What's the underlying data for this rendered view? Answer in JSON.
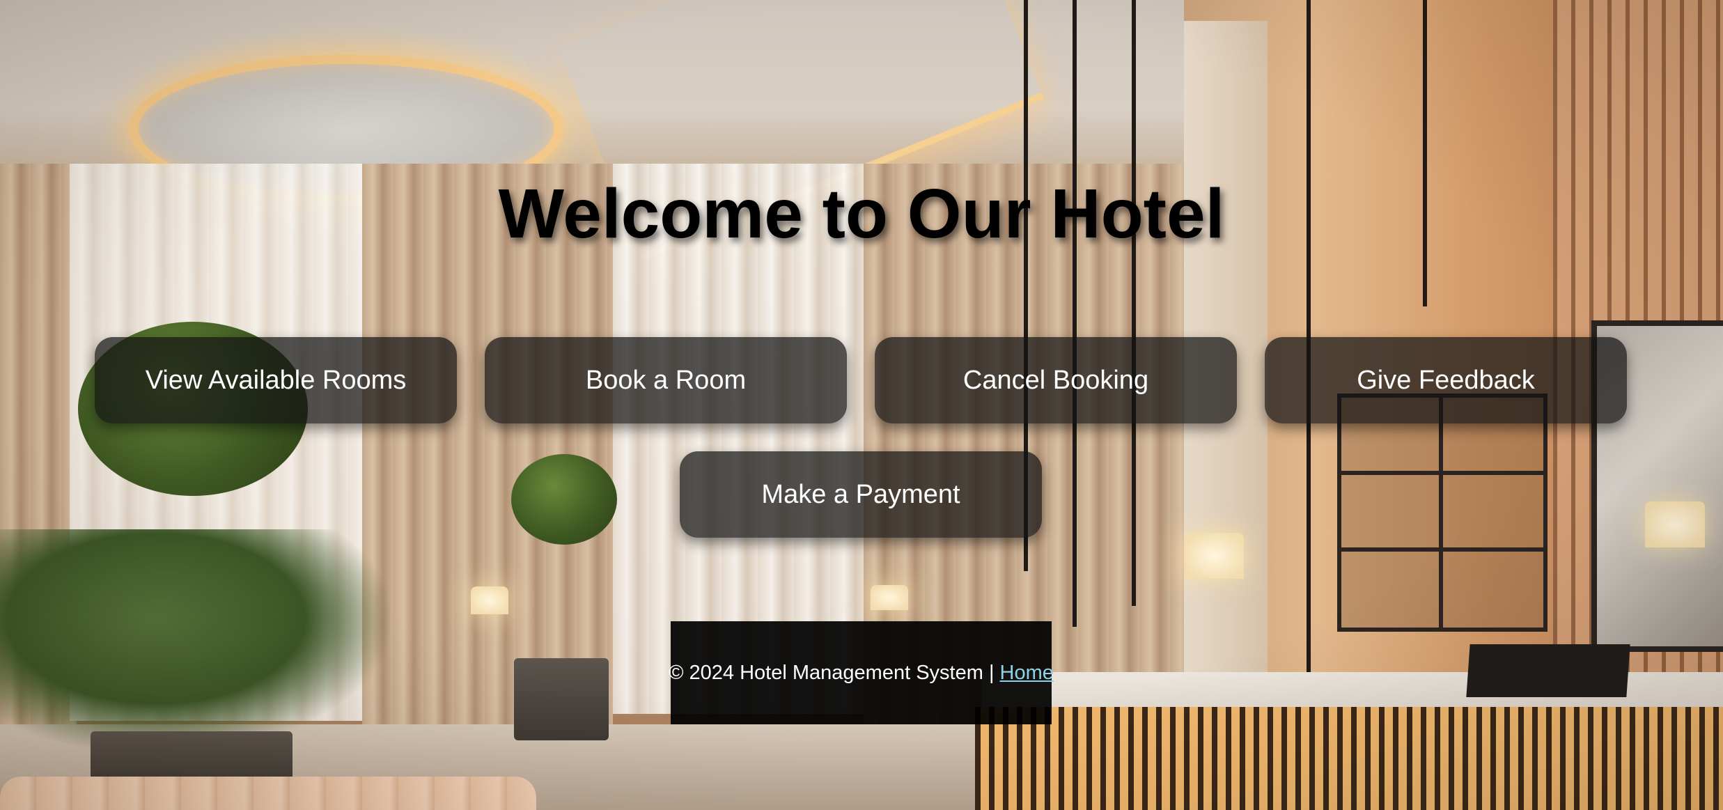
{
  "page": {
    "title": "Welcome to Our Hotel"
  },
  "menu": {
    "buttons": [
      {
        "label": "View Available Rooms"
      },
      {
        "label": "Book a Room"
      },
      {
        "label": "Cancel Booking"
      },
      {
        "label": "Give Feedback"
      },
      {
        "label": "Make a Payment"
      }
    ]
  },
  "footer": {
    "copyright": "© 2024 Hotel Management System",
    "separator": "|",
    "home_link": "Home"
  },
  "colors": {
    "title_text": "#000000",
    "button_bg": "#141414",
    "button_text": "#ffffff",
    "footer_bg": "#000000",
    "link": "#8fd3e8"
  }
}
